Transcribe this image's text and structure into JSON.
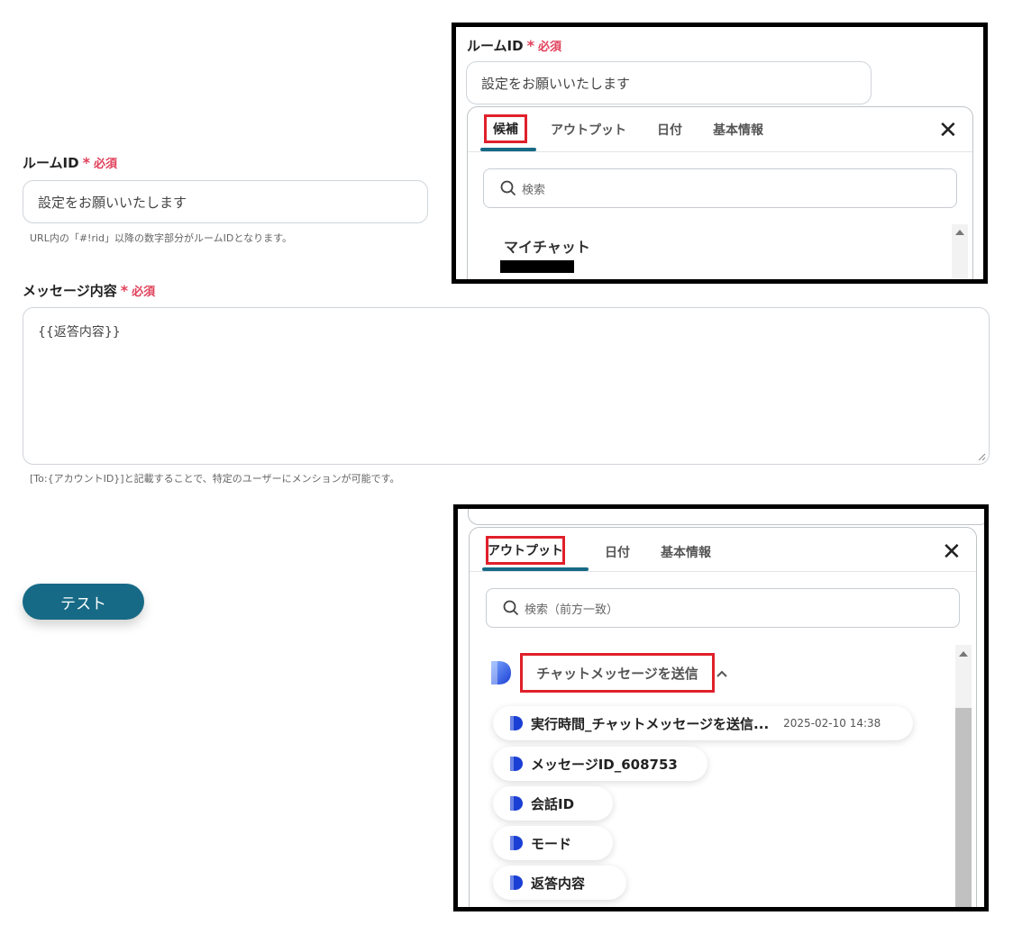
{
  "form": {
    "room_id": {
      "label": "ルームID",
      "required": "必須",
      "value": "設定をお願いいたします",
      "hint": "URL内の「#!rid」以降の数字部分がルームIDとなります。"
    },
    "message": {
      "label": "メッセージ内容",
      "required": "必須",
      "value": "{{返答内容}}",
      "hint": "[To:{アカウントID}]と記載することで、特定のユーザーにメンションが可能です。"
    },
    "test_button": "テスト"
  },
  "popup_top": {
    "field_label": "ルームID",
    "required": "必須",
    "value": "設定をお願いいたします",
    "tabs": [
      "候補",
      "アウトプット",
      "日付",
      "基本情報"
    ],
    "active_tab": "候補",
    "search_placeholder": "検索",
    "item_title": "マイチャット",
    "item_redacted": true
  },
  "popup_bottom": {
    "tabs": [
      "アウトプット",
      "日付",
      "基本情報"
    ],
    "active_tab": "アウトプット",
    "search_placeholder": "検索（前方一致）",
    "group_title": "チャットメッセージを送信",
    "items": [
      {
        "label": "実行時間_チャットメッセージを送信...",
        "timestamp": "2025-02-10 14:38"
      },
      {
        "label": "メッセージID_608753",
        "timestamp": ""
      },
      {
        "label": "会話ID",
        "timestamp": ""
      },
      {
        "label": "モード",
        "timestamp": ""
      },
      {
        "label": "返答内容",
        "timestamp": ""
      }
    ]
  },
  "icons": {
    "close": "close-icon",
    "search": "search-icon",
    "app_logo": "dify-logo-icon",
    "chevron": "chevron-up-icon"
  },
  "colors": {
    "accent": "#176a86",
    "required": "#e0405a",
    "highlight": "#e0202a"
  }
}
